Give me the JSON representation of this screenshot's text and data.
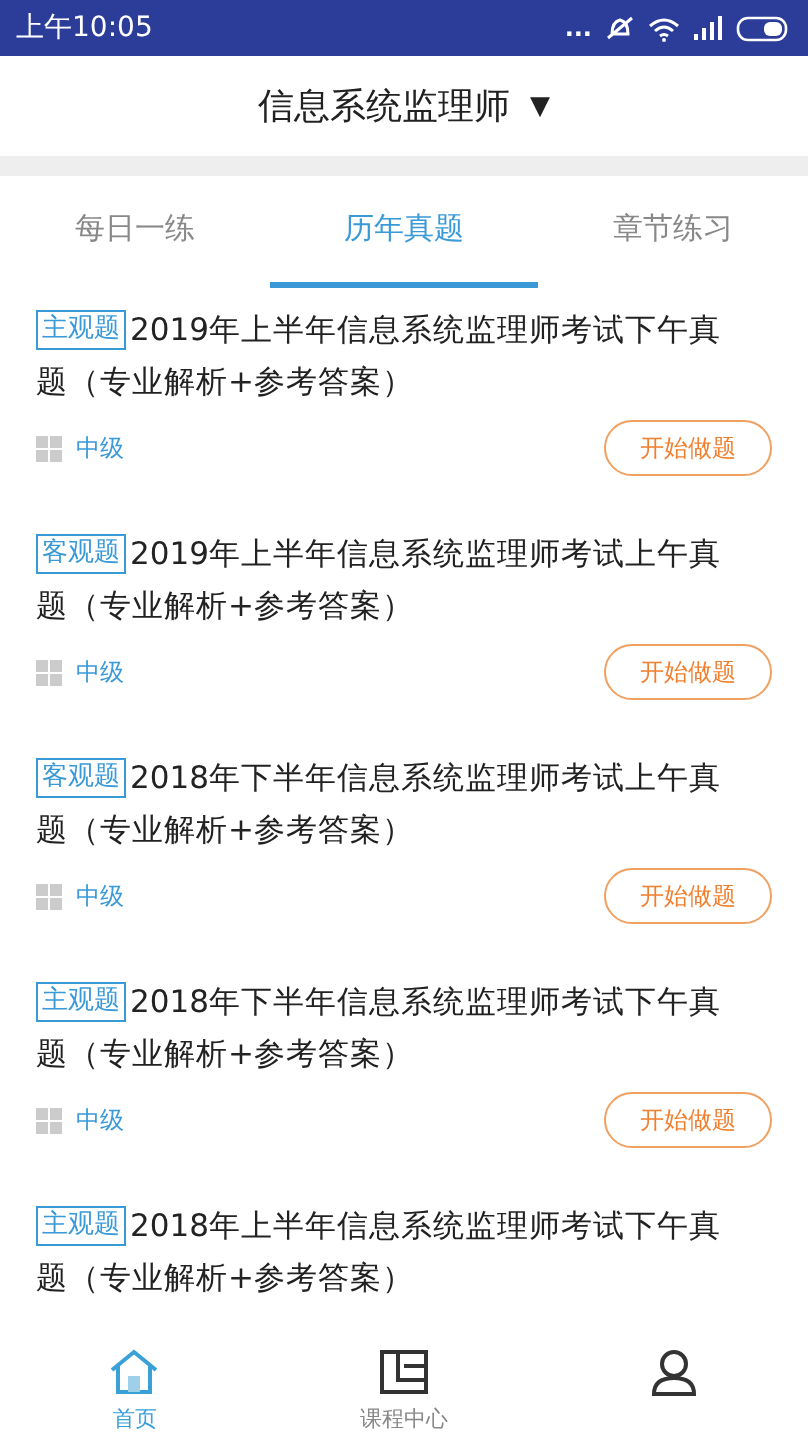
{
  "status_bar": {
    "time": "上午10:05",
    "dots": "..."
  },
  "header": {
    "title": "信息系统监理师",
    "caret": "▼"
  },
  "tabs": [
    {
      "label": "每日一练",
      "selected": false
    },
    {
      "label": "历年真题",
      "selected": true
    },
    {
      "label": "章节练习",
      "selected": false
    }
  ],
  "items": [
    {
      "tag": "主观题",
      "title": "2019年上半年信息系统监理师考试下午真题（专业解析+参考答案）",
      "level": "中级",
      "button": "开始做题"
    },
    {
      "tag": "客观题",
      "title": "2019年上半年信息系统监理师考试上午真题（专业解析+参考答案）",
      "level": "中级",
      "button": "开始做题"
    },
    {
      "tag": "客观题",
      "title": "2018年下半年信息系统监理师考试上午真题（专业解析+参考答案）",
      "level": "中级",
      "button": "开始做题"
    },
    {
      "tag": "主观题",
      "title": "2018年下半年信息系统监理师考试下午真题（专业解析+参考答案）",
      "level": "中级",
      "button": "开始做题"
    },
    {
      "tag": "主观题",
      "title": "2018年上半年信息系统监理师考试下午真题（专业解析+参考答案）"
    }
  ],
  "bottom_nav": [
    {
      "kind": "home",
      "label": "首页",
      "selected": true
    },
    {
      "kind": "course",
      "label": "课程中心",
      "selected": false
    },
    {
      "kind": "user",
      "selected": false
    }
  ]
}
